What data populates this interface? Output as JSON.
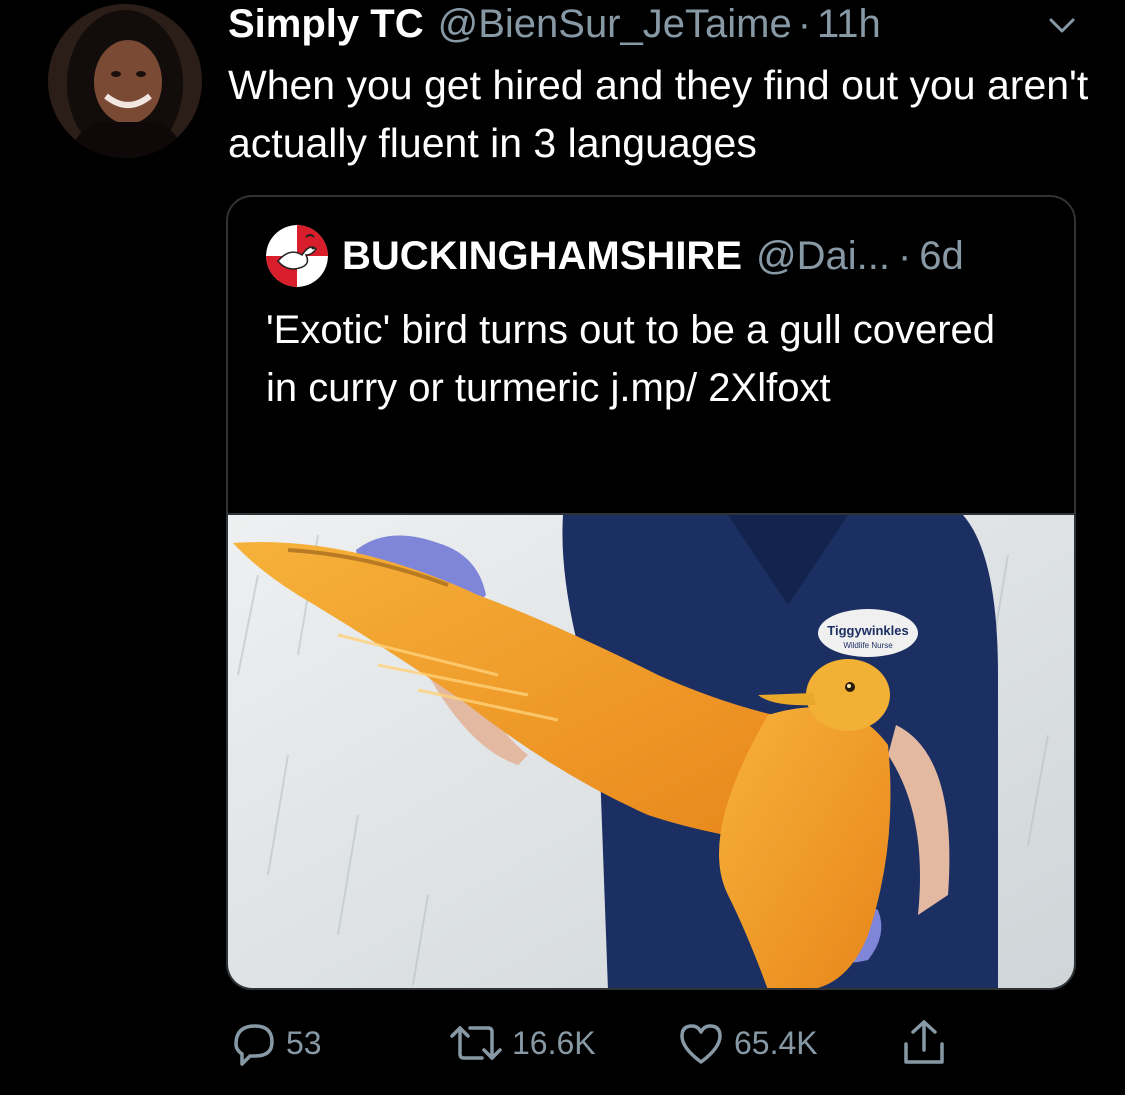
{
  "tweet": {
    "author_name": "Simply TC",
    "handle": "@BienSur_JeTaime",
    "separator": "·",
    "time": "11h",
    "text": "When you get hired and they find out you aren't actually fluent in 3 languages"
  },
  "quoted_tweet": {
    "author_name": "BUCKINGHAMSHIRE",
    "handle": "@Dai...",
    "separator": "·",
    "time": "6d",
    "text": "'Exotic' bird turns out to be a gull covered in curry or turmeric j.mp/ 2Xlfoxt",
    "image": {
      "badge_line1": "Tiggywinkles",
      "badge_line2": "Wildlife Nurse"
    }
  },
  "actions": {
    "reply_count": "53",
    "retweet_count": "16.6K",
    "like_count": "65.4K"
  },
  "colors": {
    "background": "#000000",
    "text": "#ffffff",
    "secondary": "#8899a6",
    "border": "#2f3336"
  },
  "icons": {
    "reply": "reply-icon",
    "retweet": "retweet-icon",
    "like": "heart-icon",
    "share": "share-icon",
    "caret": "chevron-down-icon"
  }
}
